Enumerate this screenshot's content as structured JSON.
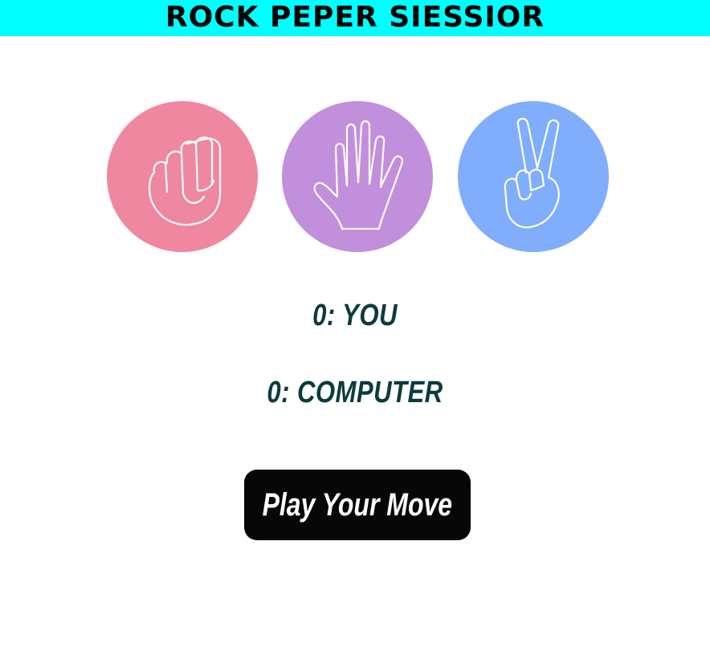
{
  "header": {
    "title": "ROCK PEPER SIESSIOR",
    "background": "#00ffff"
  },
  "choices": [
    {
      "name": "rock",
      "icon": "fist-icon",
      "color": "#f087a0"
    },
    {
      "name": "paper",
      "icon": "open-hand-icon",
      "color": "#c28fdc"
    },
    {
      "name": "scissors",
      "icon": "peace-hand-icon",
      "color": "#80aefc"
    }
  ],
  "scores": {
    "you": "0: YOU",
    "computer": "0: COMPUTER",
    "color": "#0c3b3e"
  },
  "play_button": {
    "label": "Play Your Move",
    "background": "#070707"
  }
}
